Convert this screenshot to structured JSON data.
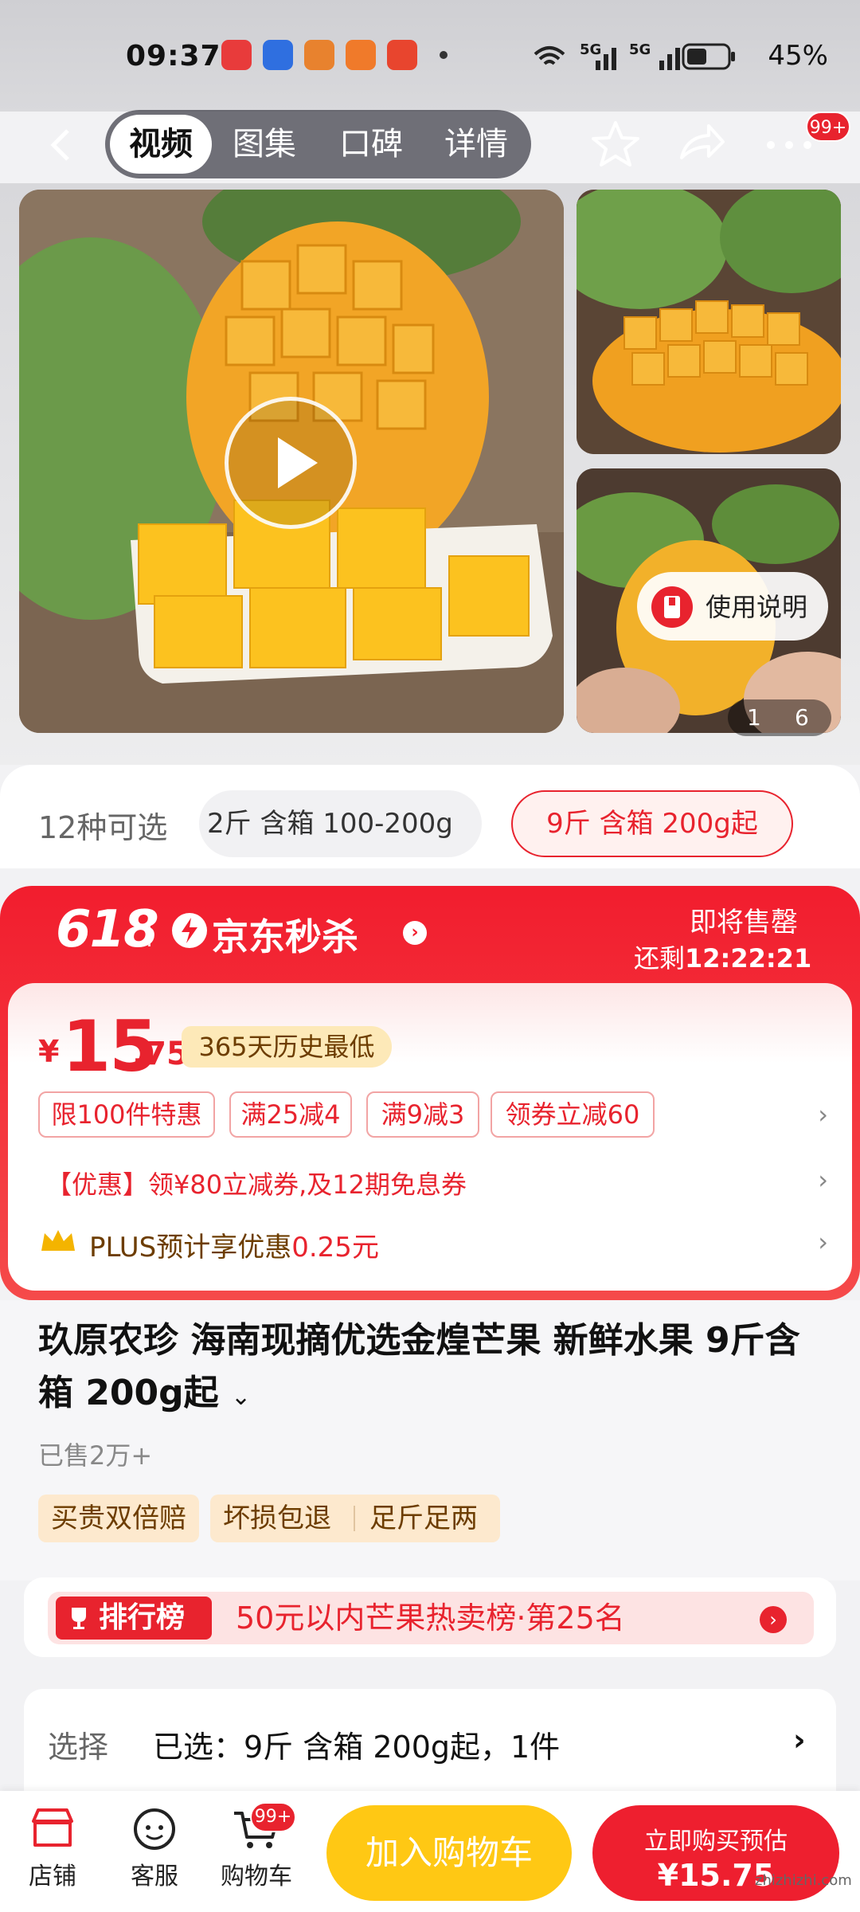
{
  "status": {
    "time": "09:37",
    "battery": "45%",
    "net1": "5G",
    "net2": "5G"
  },
  "header": {
    "tabs": [
      "视频",
      "图集",
      "口碑",
      "详情"
    ],
    "more_badge": "99+"
  },
  "gallery": {
    "manual_label": "使用说明",
    "pager_current": "1",
    "pager_total": "6"
  },
  "sku": {
    "count_label": "12种可选",
    "options": [
      "2斤 含箱 100-200g",
      "9斤 含箱 200g起"
    ]
  },
  "promo": {
    "event": "618",
    "brand": "京东秒杀",
    "soon": "即将售罄",
    "remain_label": "还剩",
    "countdown": "12:22:21",
    "currency": "¥",
    "price_int": "15",
    "price_dec": ".75",
    "low_tag": "365天历史最低",
    "tags": [
      "限100件特惠",
      "满25减4",
      "满9减3",
      "领券立减60"
    ],
    "coupon": "【优惠】领¥80立减券,及12期免息券",
    "plus_text": "PLUS预计享优惠",
    "plus_value": "0.25元"
  },
  "product": {
    "title": "玖原农珍 海南现摘优选金煌芒果 新鲜水果 9斤含箱 200g起",
    "sold": "已售2万+",
    "guarantees": [
      "买贵双倍赔",
      "坏损包退",
      "足斤足两"
    ]
  },
  "rank": {
    "badge": "排行榜",
    "text": "50元以内芒果热卖榜·第25名"
  },
  "select": {
    "label": "选择",
    "value": "已选：9斤 含箱 200g起，1件"
  },
  "bottom": {
    "store": "店铺",
    "service": "客服",
    "cart": "购物车",
    "cart_badge": "99+",
    "add_cart": "加入购物车",
    "buy_line1": "立即购买预估",
    "buy_line2": "¥15.75"
  },
  "watermark": "zhizhizhi.com",
  "colors": {
    "accent": "#e8232e",
    "promo_red": "#f21d2e",
    "cart_yellow": "#ffc814"
  }
}
